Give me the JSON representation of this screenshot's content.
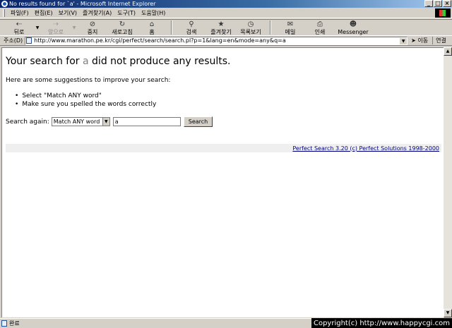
{
  "window": {
    "title": "No results found for `a' - Microsoft Internet Explorer",
    "buttons": [
      "_",
      "□",
      "×"
    ]
  },
  "menubar": {
    "items": [
      "파일(F)",
      "편집(E)",
      "보기(V)",
      "즐겨찾기(A)",
      "도구(T)",
      "도움말(H)"
    ]
  },
  "toolbar": {
    "back": "뒤로",
    "forward": "앞으로",
    "stop": "중지",
    "refresh": "새로고침",
    "home": "홈",
    "search": "검색",
    "favorites": "즐겨찾기",
    "history": "목록보기",
    "mail": "메일",
    "print": "인쇄",
    "messenger": "Messenger",
    "icons": {
      "back": "back-arrow-icon",
      "forward": "forward-arrow-icon",
      "stop": "stop-icon",
      "refresh": "refresh-icon",
      "home": "home-icon",
      "search": "search-icon",
      "favorites": "favorites-icon",
      "history": "history-icon",
      "mail": "mail-icon",
      "print": "print-icon",
      "messenger": "messenger-icon"
    }
  },
  "addressbar": {
    "label": "주소(D)",
    "url": "http://www.marathon.pe.kr/cgi/perfect/search/search.pl?p=1&lang=en&mode=any&q=a",
    "go_label": "이동",
    "links_label": "연결"
  },
  "page": {
    "heading_prefix": "Your search for",
    "heading_term": "a",
    "heading_suffix": "did not produce any results.",
    "suggest_intro": "Here are some suggestions to improve your search:",
    "suggestions": [
      "Select \"Match ANY word\"",
      "Make sure you spelled the words correctly"
    ],
    "search_again_label": "Search again:",
    "match_mode_selected": "Match ANY word",
    "query_value": "a",
    "search_button": "Search",
    "footer_link": "Perfect Search 3.20 (c) Perfect Solutions 1998-2000",
    "link_color": "#00007f",
    "term_color": "#808080"
  },
  "statusbar": {
    "status_text": "완료",
    "copyright": "Copyright(c) http://www.happycgi.com"
  }
}
